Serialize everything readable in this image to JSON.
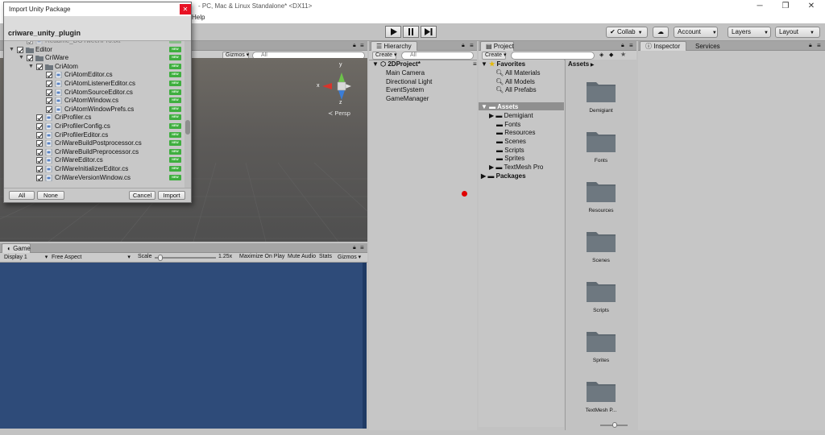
{
  "window": {
    "title": "- PC, Mac & Linux Standalone* <DX11>",
    "menu_help": "Help"
  },
  "toolbar": {
    "collab": "Collab",
    "account": "Account",
    "layers": "Layers",
    "layout": "Layout"
  },
  "scene": {
    "gizmos": "Gizmos",
    "search_placeholder": "All",
    "persp": "Persp",
    "axis_x": "x",
    "axis_y": "y",
    "axis_z": "z"
  },
  "game": {
    "tab": "Game",
    "display": "Display 1",
    "aspect": "Free Aspect",
    "scale_label": "Scale",
    "scale_value": "1.25x",
    "scale_level": 0.06,
    "maximize": "Maximize On Play",
    "mute": "Mute Audio",
    "stats": "Stats",
    "gizmos": "Gizmos"
  },
  "hierarchy": {
    "tab": "Hierarchy",
    "create": "Create",
    "search_placeholder": "All",
    "scene_name": "2DProject*",
    "items": [
      "Main Camera",
      "Directional Light",
      "EventSystem",
      "GameManager"
    ]
  },
  "project": {
    "tab": "Project",
    "create": "Create",
    "favorites": "Favorites",
    "favorite_items": [
      "All Materials",
      "All Models",
      "All Prefabs"
    ],
    "assets": "Assets",
    "asset_folders": [
      "Demigiant",
      "Fonts",
      "Resources",
      "Scenes",
      "Scripts",
      "Sprites",
      "TextMesh Pro"
    ],
    "packages": "Packages",
    "breadcrumb": "Assets",
    "tiles": [
      "Demigiant",
      "Fonts",
      "Resources",
      "Scenes",
      "Scripts",
      "Sprites",
      "TextMesh P..."
    ]
  },
  "inspector": {
    "tab": "Inspector",
    "services": "Services"
  },
  "dialog": {
    "title": "Import Unity Package",
    "close": "✕",
    "package_name": "criware_unity_plugin",
    "badge": "NEW",
    "rows": [
      {
        "label": "Readme_DOTweenPro.txt",
        "depth": 1,
        "type": "file",
        "faded": true
      },
      {
        "label": "Editor",
        "depth": 0,
        "type": "folder"
      },
      {
        "label": "CriWare",
        "depth": 1,
        "type": "folder"
      },
      {
        "label": "CriAtom",
        "depth": 2,
        "type": "folder"
      },
      {
        "label": "CriAtomEditor.cs",
        "depth": 3,
        "type": "file"
      },
      {
        "label": "CriAtomListenerEditor.cs",
        "depth": 3,
        "type": "file"
      },
      {
        "label": "CriAtomSourceEditor.cs",
        "depth": 3,
        "type": "file"
      },
      {
        "label": "CriAtomWindow.cs",
        "depth": 3,
        "type": "file"
      },
      {
        "label": "CriAtomWindowPrefs.cs",
        "depth": 3,
        "type": "file"
      },
      {
        "label": "CriProfiler.cs",
        "depth": 2,
        "type": "file"
      },
      {
        "label": "CriProfilerConfig.cs",
        "depth": 2,
        "type": "file"
      },
      {
        "label": "CriProfilerEditor.cs",
        "depth": 2,
        "type": "file"
      },
      {
        "label": "CriWareBuildPostprocessor.cs",
        "depth": 2,
        "type": "file"
      },
      {
        "label": "CriWareBuildPreprocessor.cs",
        "depth": 2,
        "type": "file"
      },
      {
        "label": "CriWareEditor.cs",
        "depth": 2,
        "type": "file"
      },
      {
        "label": "CriWareInitializerEditor.cs",
        "depth": 2,
        "type": "file"
      },
      {
        "label": "CriWareVersionWindow.cs",
        "depth": 2,
        "type": "file"
      }
    ],
    "btn_all": "All",
    "btn_none": "None",
    "btn_cancel": "Cancel",
    "btn_import": "Import"
  },
  "colors": {
    "game_bg": "#2e4b79",
    "new_badge": "#3fae3f",
    "close_red": "#e81123",
    "record_dot": "#e00000"
  }
}
